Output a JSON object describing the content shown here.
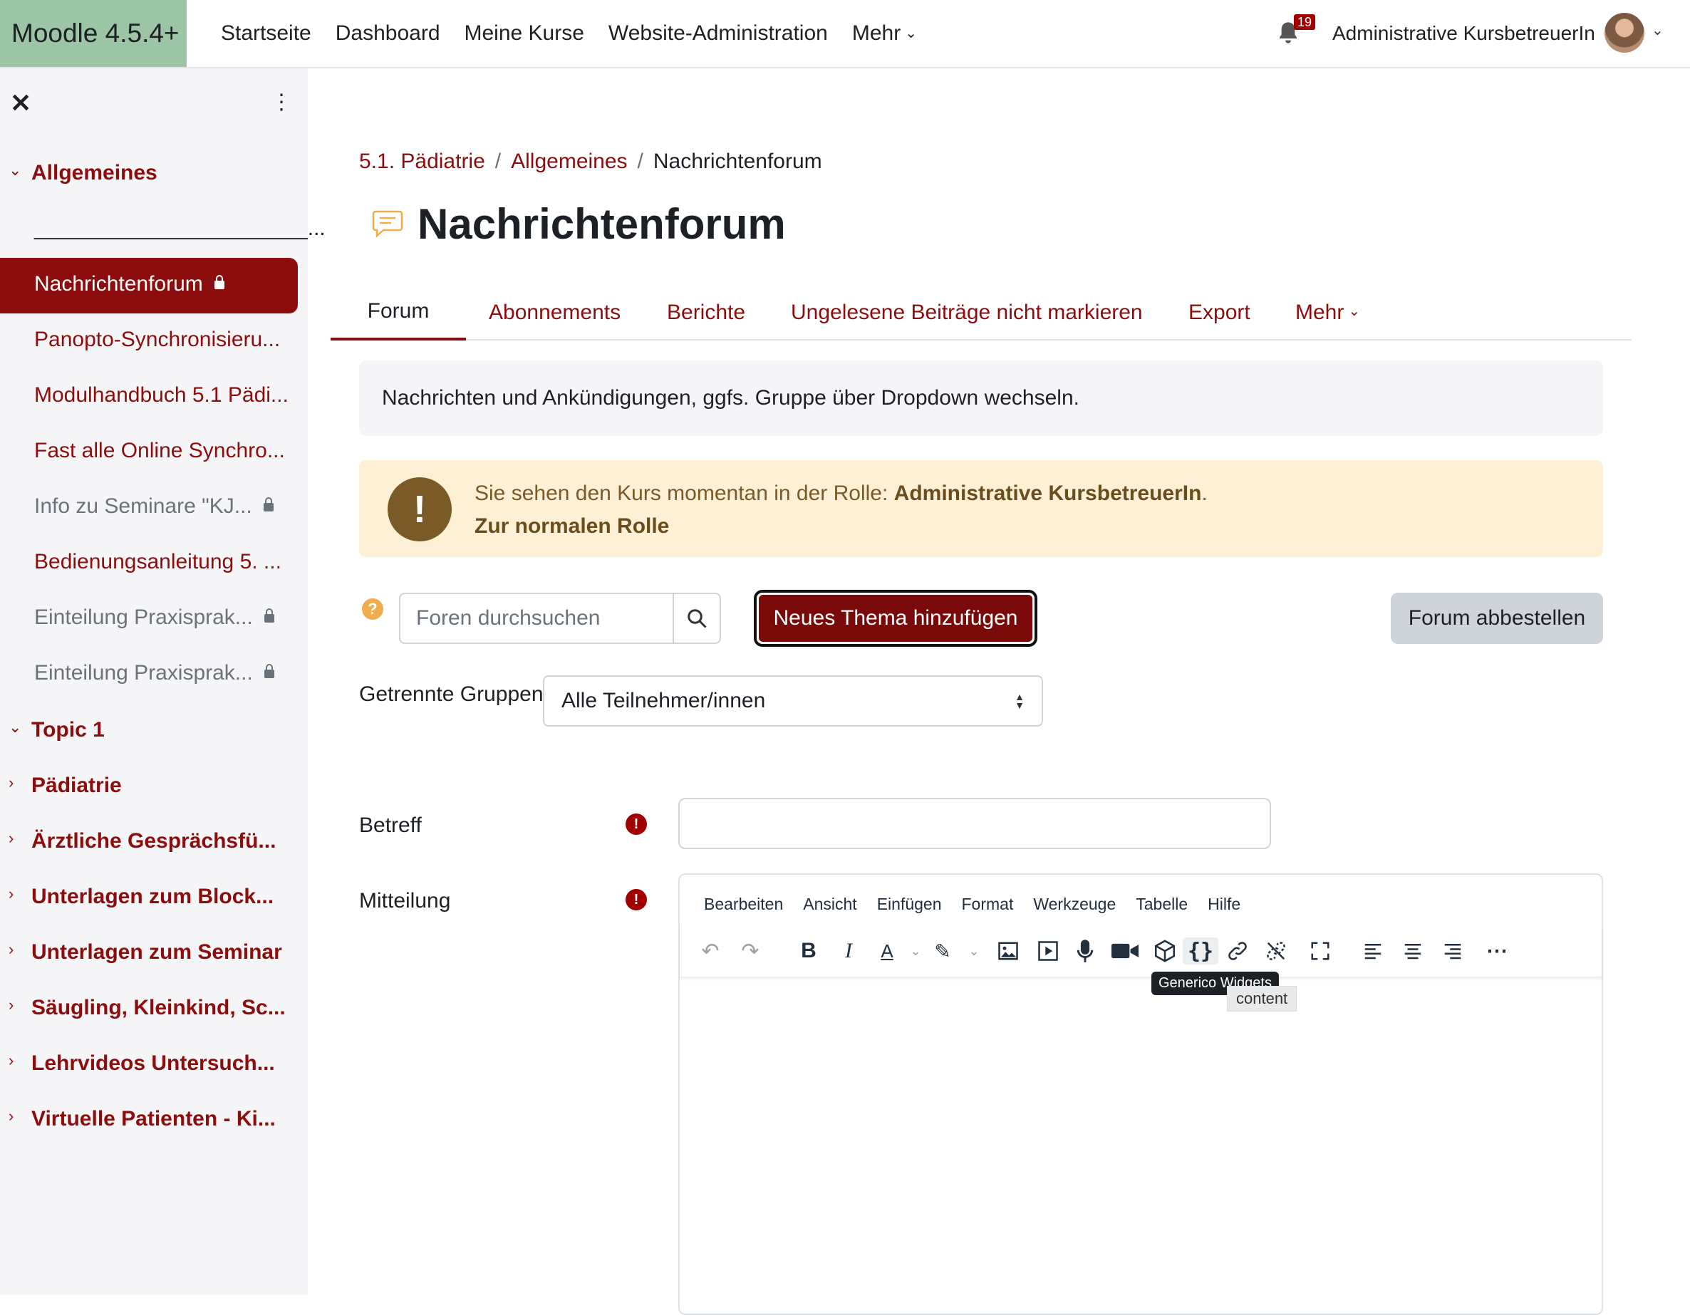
{
  "navbar": {
    "brand": "Moodle 4.5.4+",
    "links": [
      "Startseite",
      "Dashboard",
      "Meine Kurse",
      "Website-Administration"
    ],
    "more": "Mehr",
    "notification_count": "19",
    "user_name": "Administrative KursbetreuerIn"
  },
  "sidebar": {
    "sections": [
      {
        "title": "Allgemeines",
        "expanded": true
      },
      {
        "title": "Topic 1",
        "expanded": true
      },
      {
        "title": "Pädiatrie",
        "expanded": false
      },
      {
        "title": "Ärztliche Gesprächsfü...",
        "expanded": false
      },
      {
        "title": "Unterlagen zum Block...",
        "expanded": false
      },
      {
        "title": "Unterlagen zum Seminar",
        "expanded": false
      },
      {
        "title": "Säugling, Kleinkind, Sc...",
        "expanded": false
      },
      {
        "title": "Lehrvideos Untersuch...",
        "expanded": false
      },
      {
        "title": "Virtuelle Patienten - Ki...",
        "expanded": false
      }
    ],
    "items": [
      {
        "label": "_______________________..."
      },
      {
        "label": "Nachrichtenforum"
      },
      {
        "label": "Panopto-Synchronisieru..."
      },
      {
        "label": "Modulhandbuch 5.1 Pädi..."
      },
      {
        "label": "Fast alle Online Synchro..."
      },
      {
        "label": "Info zu Seminare \"KJ..."
      },
      {
        "label": "Bedienungsanleitung 5. ..."
      },
      {
        "label": "Einteilung Praxisprak..."
      },
      {
        "label": "Einteilung Praxisprak..."
      }
    ]
  },
  "breadcrumb": [
    "5.1. Pädiatrie",
    "Allgemeines",
    "Nachrichtenforum"
  ],
  "page_title": "Nachrichtenforum",
  "tabs": [
    "Forum",
    "Abonnements",
    "Berichte",
    "Ungelesene Beiträge nicht markieren",
    "Export",
    "Mehr"
  ],
  "info_text": "Nachrichten und Ankündigungen, ggfs. Gruppe über Dropdown wechseln.",
  "role_notice": {
    "text": "Sie sehen den Kurs momentan in der Rolle: ",
    "role": "Administrative KursbetreuerIn",
    "dot": ".",
    "link": "Zur normalen Rolle"
  },
  "search": {
    "placeholder": "Foren durchsuchen"
  },
  "buttons": {
    "new_topic": "Neues Thema hinzufügen",
    "unsubscribe": "Forum abbestellen"
  },
  "groups": {
    "label": "Getrennte Gruppen",
    "selected": "Alle Teilnehmer/innen"
  },
  "form": {
    "subject_label": "Betreff",
    "message_label": "Mitteilung"
  },
  "editor": {
    "menu": [
      "Bearbeiten",
      "Ansicht",
      "Einfügen",
      "Format",
      "Werkzeuge",
      "Tabelle",
      "Hilfe"
    ],
    "tooltip": "Generico Widgets",
    "tooltip2": "content"
  },
  "colors": {
    "brand_bg": "#9bc5a4",
    "accent": "#8c0d0d",
    "primary_button": "#7a0909",
    "warning_bg": "#fdf0d5"
  }
}
